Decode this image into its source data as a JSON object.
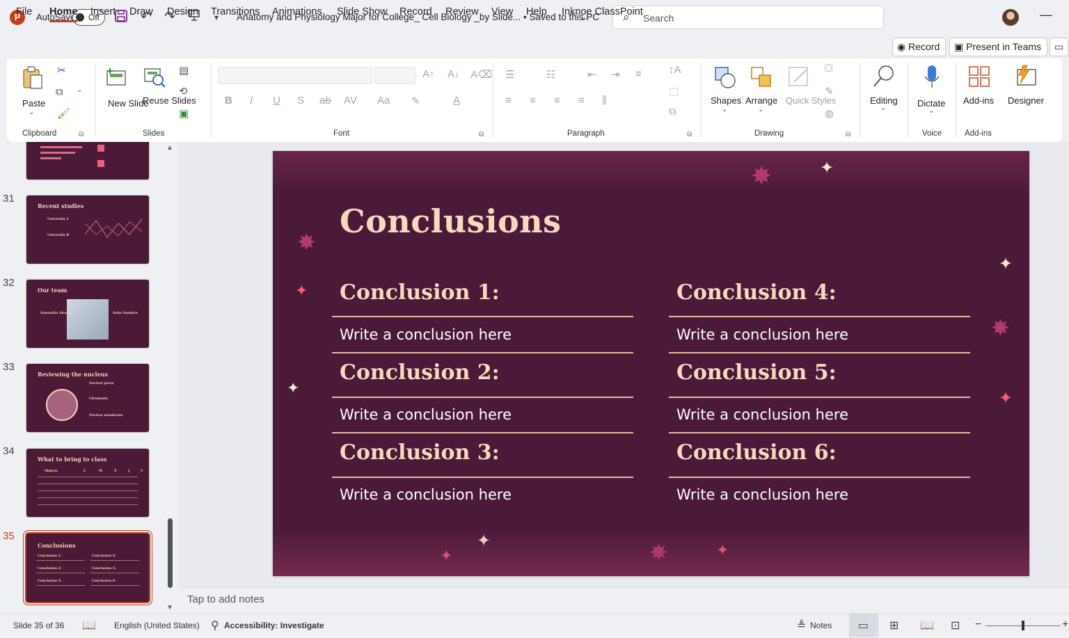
{
  "titlebar": {
    "autosave_label": "AutoSave",
    "autosave_state": "Off",
    "document_title": "Anatomy and Physiology Major for College_ Cell Biology _by Slide... • Saved to this PC",
    "search_placeholder": "Search"
  },
  "menu": {
    "tabs": [
      "File",
      "Home",
      "Insert",
      "Draw",
      "Design",
      "Transitions",
      "Animations",
      "Slide Show",
      "Record",
      "Review",
      "View",
      "Help",
      "Inknoe ClassPoint"
    ],
    "active": "Home",
    "record_button": "Record",
    "present_button": "Present in Teams"
  },
  "ribbon": {
    "clipboard": {
      "label": "Clipboard",
      "paste": "Paste"
    },
    "slides": {
      "label": "Slides",
      "new_slide": "New Slide",
      "reuse_slides": "Reuse Slides"
    },
    "font": {
      "label": "Font"
    },
    "paragraph": {
      "label": "Paragraph"
    },
    "drawing": {
      "label": "Drawing",
      "shapes": "Shapes",
      "arrange": "Arrange",
      "quick_styles": "Quick Styles"
    },
    "editing": {
      "label": "Editing"
    },
    "voice": {
      "label": "Voice",
      "dictate": "Dictate"
    },
    "addins": {
      "label": "Add-ins",
      "addins_btn": "Add-ins",
      "designer": "Designer"
    }
  },
  "thumbnails": [
    {
      "num": "",
      "title": "",
      "partial": true
    },
    {
      "num": "31",
      "title": "Recent studies",
      "sub": [
        "University A",
        "University B"
      ]
    },
    {
      "num": "32",
      "title": "Our team",
      "sub": [
        "Samantha Alvarado",
        "Salsa Sandara"
      ]
    },
    {
      "num": "33",
      "title": "Reviewing the nucleus",
      "sub": [
        "Nuclear pores",
        "Chromatin",
        "Nuclear membrane"
      ]
    },
    {
      "num": "34",
      "title": "What to bring to class",
      "sub": [
        "Objects",
        "L",
        "M",
        "X",
        "J",
        "V"
      ]
    },
    {
      "num": "35",
      "title": "Conclusions",
      "sub": [
        "Conclusion 1:",
        "Conclusion 4:",
        "Conclusion 2:",
        "Conclusion 5:",
        "Conclusion 3:",
        "Conclusion 6:"
      ],
      "selected": true
    }
  ],
  "slide": {
    "title": "Conclusions",
    "items": [
      {
        "heading": "Conclusion 1:",
        "body": "Write a conclusion here"
      },
      {
        "heading": "Conclusion 2:",
        "body": "Write a conclusion here"
      },
      {
        "heading": "Conclusion 3:",
        "body": "Write a conclusion here"
      },
      {
        "heading": "Conclusion 4:",
        "body": "Write a conclusion here"
      },
      {
        "heading": "Conclusion 5:",
        "body": "Write a conclusion here"
      },
      {
        "heading": "Conclusion 6:",
        "body": "Write a conclusion here"
      }
    ],
    "colors": {
      "background": "#4b1a39",
      "heading": "#fad7bd",
      "body": "#ffffff",
      "accent_pink": "#f0607a",
      "accent_cream": "#fde6cf"
    }
  },
  "notes": {
    "placeholder": "Tap to add notes"
  },
  "status": {
    "slide_counter": "Slide 35 of 36",
    "language": "English (United States)",
    "accessibility": "Accessibility: Investigate",
    "notes_button": "Notes"
  },
  "colors": {
    "accent": "#c43e1c"
  }
}
